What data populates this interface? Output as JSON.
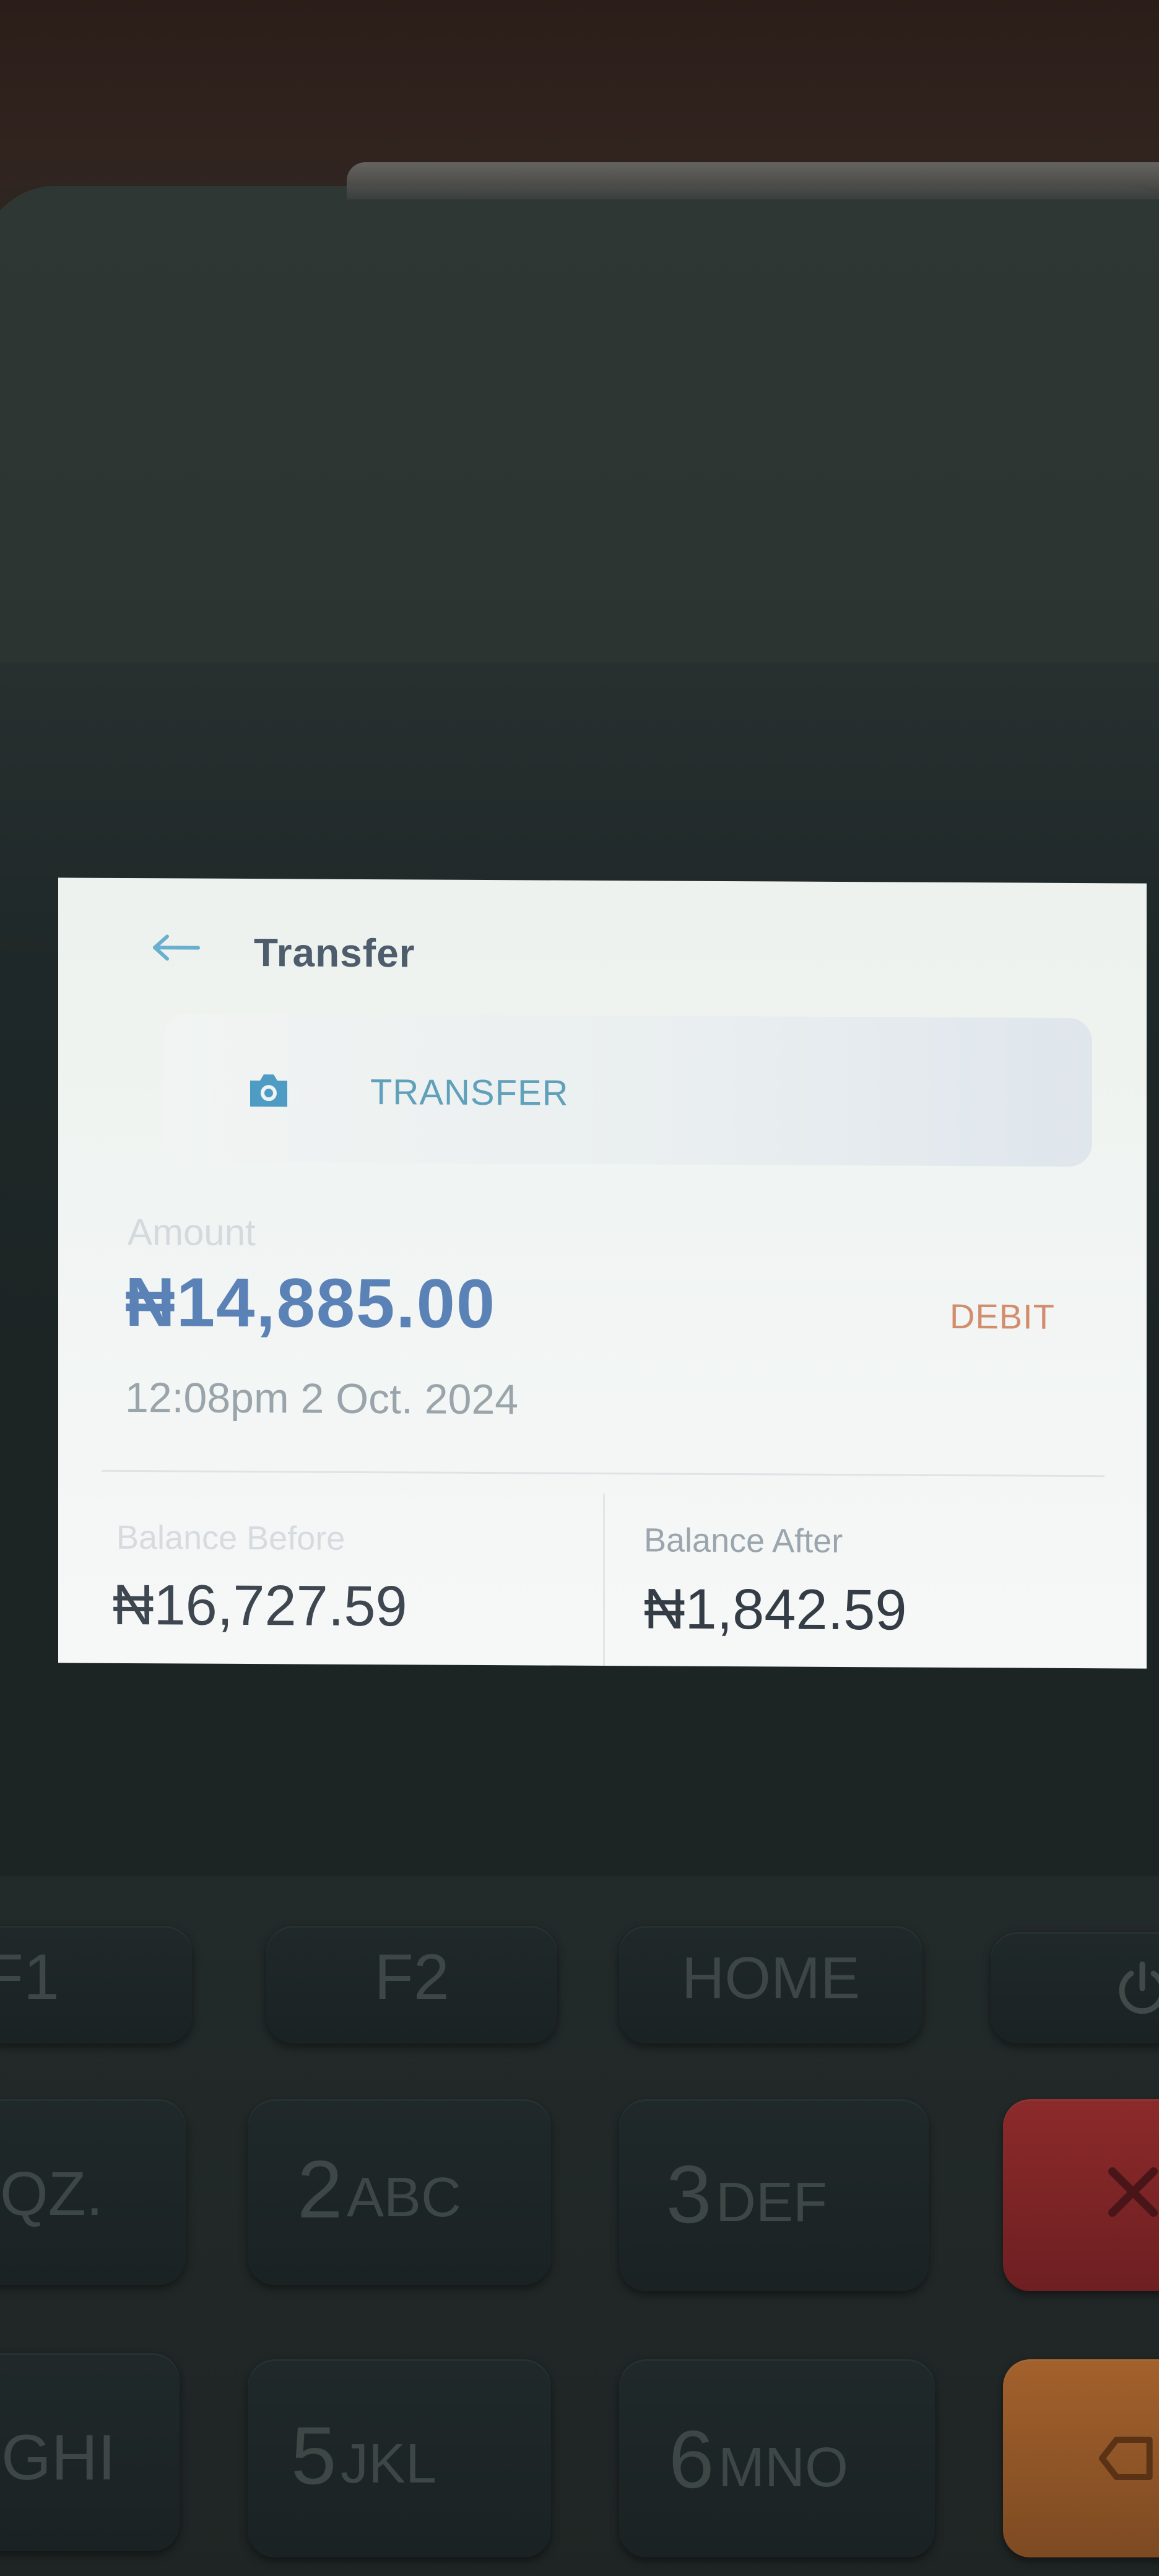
{
  "header": {
    "title": "Transfer",
    "back_icon": "arrow-left-icon"
  },
  "transaction": {
    "type_icon": "camera-icon",
    "type_label": "TRANSFER",
    "amount_label": "Amount",
    "amount": "₦14,885.00",
    "direction": "DEBIT",
    "timestamp": "12:08pm 2 Oct. 2024"
  },
  "balances": {
    "before_label": "Balance Before",
    "before_value": "₦16,727.59",
    "after_label": "Balance After",
    "after_value": "₦1,842.59"
  },
  "keypad": {
    "f1": "F1",
    "f2": "F2",
    "home": "HOME",
    "power_icon": "power-icon",
    "key1": {
      "number": "",
      "letters": "QZ."
    },
    "key2": {
      "number": "2",
      "letters": "ABC"
    },
    "key3": {
      "number": "3",
      "letters": "DEF"
    },
    "key4": {
      "number": "",
      "letters": "GHI"
    },
    "key5": {
      "number": "5",
      "letters": "JKL"
    },
    "key6": {
      "number": "6",
      "letters": "MNO"
    },
    "cancel_icon": "close-icon",
    "clear_icon": "clear-icon"
  },
  "colors": {
    "amount": "#5b82b6",
    "debit": "#d28d6c",
    "transfer_accent": "#5fa0ba",
    "cancel_key": "#8c2a2a",
    "clear_key": "#a3612c"
  }
}
